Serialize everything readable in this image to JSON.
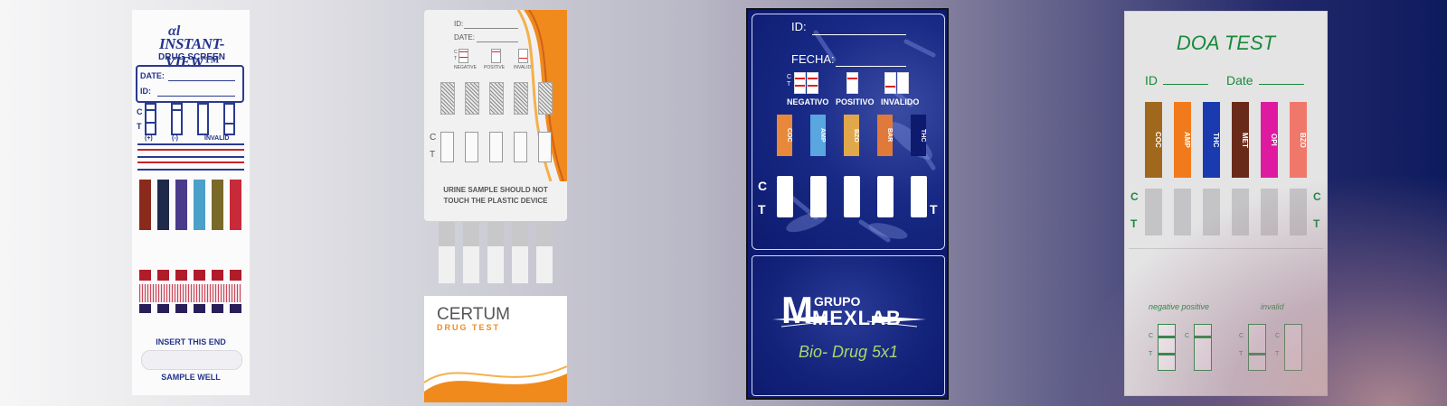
{
  "cards": {
    "instant_view": {
      "logo": "αl",
      "brand": "INSTANT-VIEW™",
      "subtitle": "DRUG SCREEN",
      "date_label": "DATE:",
      "id_label": "ID:",
      "c_label": "C",
      "t_label": "T",
      "neg_label": "(+)",
      "pos_label": "(-)",
      "invalid_label": "INVALID",
      "insert_label": "INSERT THIS END",
      "sample_label": "SAMPLE WELL",
      "stripe_colors": [
        "#8a2a1c",
        "#1f2a4a",
        "#4a3a8a",
        "#4aa0c8",
        "#7a6a2a",
        "#c82a3a"
      ]
    },
    "certum": {
      "id_label": "ID:",
      "date_label": "DATE:",
      "ct_label": "C T",
      "negative_label": "NEGATIVE",
      "positive_label": "POSITIVE",
      "invalid_label": "INVALID",
      "c_label": "C",
      "t_label": "T",
      "warning_line1": "URINE SAMPLE SHOULD NOT",
      "warning_line2": "TOUCH THE PLASTIC DEVICE",
      "brand": "CERTUM",
      "brand_sub": "DRUG TEST",
      "accent_color": "#f08a1c"
    },
    "mexlab": {
      "id_label": "ID:",
      "fecha_label": "FECHA:",
      "ct_label": "C T",
      "negativo_label": "NEGATIVO",
      "positivo_label": "POSITIVO",
      "invalido_label": "INVALIDO",
      "drugs": [
        "COC",
        "AMP",
        "BZO",
        "BAR",
        "THC"
      ],
      "drug_colors": [
        "#e8883a",
        "#5aa6e0",
        "#e0a84a",
        "#e07a3a",
        "#0d1a6e"
      ],
      "c_label": "C",
      "t_label": "T",
      "brand_top": "GRUPO",
      "brand_main": "MEXLAB",
      "brand_m": "M",
      "product": "Bio- Drug 5x1"
    },
    "doa": {
      "title": "DOA TEST",
      "id_label": "ID",
      "date_label": "Date",
      "drugs": [
        "COC",
        "AMP",
        "THC",
        "MET",
        "OPI",
        "BZO"
      ],
      "drug_colors": [
        "#a0681c",
        "#f07a1c",
        "#1a3ab0",
        "#6a2a1a",
        "#e01aa0",
        "#f0786a"
      ],
      "c_label": "C",
      "t_label": "T",
      "neg_pos_label": "negative positive",
      "invalid_label": "invalid",
      "accent_color": "#1a8a3a"
    }
  }
}
